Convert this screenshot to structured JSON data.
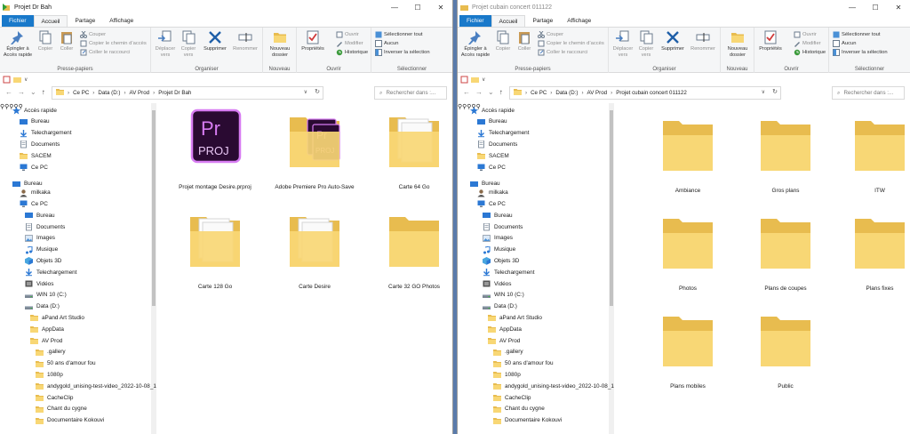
{
  "left": {
    "window_title": "Projet Dr Bah",
    "tabs": [
      "Fichier",
      "Accueil",
      "Partage",
      "Affichage"
    ],
    "ribbon": {
      "pin_label": "Épingler à Accès rapide",
      "copy_label": "Copier",
      "paste_label": "Coller",
      "cut_label": "Couper",
      "copy_path_label": "Copier le chemin d’accès",
      "paste_shortcut_label": "Coller le raccourci",
      "clipboard_group": "Presse-papiers",
      "move_to_label": "Déplacer vers",
      "copy_to_label": "Copier vers",
      "delete_label": "Supprimer",
      "rename_label": "Renommer",
      "organize_group": "Organiser",
      "new_folder_label": "Nouveau dossier",
      "new_group": "Nouveau",
      "properties_label": "Propriétés",
      "open_label": "Ouvrir",
      "modify_label": "Modifier",
      "history_label": "Historique",
      "open_group": "Ouvrir",
      "select_all_label": "Sélectionner tout",
      "select_none_label": "Aucun",
      "invert_label": "Inverser la sélection",
      "select_group": "Sélectionner"
    },
    "breadcrumb": [
      "Ce PC",
      "Data (D:)",
      "AV Prod",
      "Projet Dr Bah"
    ],
    "search_placeholder": "Rechercher dans :...",
    "nav": [
      {
        "label": "Accès rapide",
        "icon": "star-icon",
        "indent": 0,
        "pin": false
      },
      {
        "label": "Bureau",
        "icon": "desktop-icon",
        "indent": 1,
        "pin": true
      },
      {
        "label": "Telechargement",
        "icon": "download-icon",
        "indent": 1,
        "pin": true
      },
      {
        "label": "Documents",
        "icon": "documents-icon",
        "indent": 1,
        "pin": true
      },
      {
        "label": "SACEM",
        "icon": "folder-icon",
        "indent": 1,
        "pin": true
      },
      {
        "label": "Ce PC",
        "icon": "pc-icon",
        "indent": 1,
        "pin": true
      },
      {
        "label": "Bureau",
        "icon": "desktop-icon",
        "indent": 0,
        "pin": false
      },
      {
        "label": "milkaka",
        "icon": "user-icon",
        "indent": 1,
        "pin": false
      },
      {
        "label": "Ce PC",
        "icon": "pc-icon",
        "indent": 1,
        "pin": false
      },
      {
        "label": "Bureau",
        "icon": "desktop-icon",
        "indent": 2,
        "pin": false
      },
      {
        "label": "Documents",
        "icon": "documents-icon",
        "indent": 2,
        "pin": false
      },
      {
        "label": "Images",
        "icon": "images-icon",
        "indent": 2,
        "pin": false
      },
      {
        "label": "Musique",
        "icon": "music-icon",
        "indent": 2,
        "pin": false
      },
      {
        "label": "Objets 3D",
        "icon": "cube-icon",
        "indent": 2,
        "pin": false
      },
      {
        "label": "Telechargement",
        "icon": "download-icon",
        "indent": 2,
        "pin": false
      },
      {
        "label": "Vidéos",
        "icon": "video-icon",
        "indent": 2,
        "pin": false
      },
      {
        "label": "WIN 10 (C:)",
        "icon": "drive-icon",
        "indent": 2,
        "pin": false
      },
      {
        "label": "Data (D:)",
        "icon": "drive-icon",
        "indent": 2,
        "pin": false
      },
      {
        "label": "aPand Art Studio",
        "icon": "folder-icon",
        "indent": 3,
        "pin": false
      },
      {
        "label": "AppData",
        "icon": "folder-icon",
        "indent": 3,
        "pin": false
      },
      {
        "label": "AV Prod",
        "icon": "folder-icon",
        "indent": 3,
        "pin": false
      },
      {
        "label": ".gallery",
        "icon": "folder-icon",
        "indent": 4,
        "pin": false
      },
      {
        "label": "50 ans d'amour fou",
        "icon": "folder-icon",
        "indent": 4,
        "pin": false
      },
      {
        "label": "1080p",
        "icon": "folder-icon",
        "indent": 4,
        "pin": false
      },
      {
        "label": "andygold_unising-test-video_2022-10-08_13",
        "icon": "folder-icon",
        "indent": 4,
        "pin": false
      },
      {
        "label": "CacheClip",
        "icon": "folder-icon",
        "indent": 4,
        "pin": false
      },
      {
        "label": "Chant du cygne",
        "icon": "folder-icon",
        "indent": 4,
        "pin": false
      },
      {
        "label": "Documentaire Kokouvi",
        "icon": "folder-icon",
        "indent": 4,
        "pin": false
      }
    ],
    "items": [
      {
        "label": "Projet montage Desire.prproj",
        "kind": "prproj",
        "icon_text_top": "Pr",
        "icon_text_bottom": "PROJ"
      },
      {
        "label": "Adobe Premiere Pro Auto-Save",
        "kind": "folder-prproj",
        "icon_text_top": "Pr",
        "icon_text_bottom": "PROJ"
      },
      {
        "label": "Carte 64 Go",
        "kind": "folder-papers"
      },
      {
        "label": "Carte 128 Go",
        "kind": "folder-papers"
      },
      {
        "label": "Carte Desire",
        "kind": "folder-papers"
      },
      {
        "label": "Carte 32 GO Photos",
        "kind": "folder"
      }
    ]
  },
  "right": {
    "window_title": "Projet cubain concert 011122",
    "tabs": [
      "Fichier",
      "Accueil",
      "Partage",
      "Affichage"
    ],
    "ribbon": {
      "pin_label": "Épingler à Accès rapide",
      "copy_label": "Copier",
      "paste_label": "Coller",
      "cut_label": "Couper",
      "copy_path_label": "Copier le chemin d’accès",
      "paste_shortcut_label": "Coller le raccourci",
      "clipboard_group": "Presse-papiers",
      "move_to_label": "Déplacer vers",
      "copy_to_label": "Copier vers",
      "delete_label": "Supprimer",
      "rename_label": "Renommer",
      "organize_group": "Organiser",
      "new_folder_label": "Nouveau dossier",
      "new_group": "Nouveau",
      "properties_label": "Propriétés",
      "open_label": "Ouvrir",
      "modify_label": "Modifier",
      "history_label": "Historique",
      "open_group": "Ouvrir",
      "select_all_label": "Sélectionner tout",
      "select_none_label": "Aucun",
      "invert_label": "Inverser la sélection",
      "select_group": "Sélectionner"
    },
    "breadcrumb": [
      "Ce PC",
      "Data (D:)",
      "AV Prod",
      "Projet cubain concert 011122"
    ],
    "search_placeholder": "Rechercher dans :...",
    "nav": [
      {
        "label": "Accès rapide",
        "icon": "star-icon",
        "indent": 0,
        "pin": false
      },
      {
        "label": "Bureau",
        "icon": "desktop-icon",
        "indent": 1,
        "pin": true
      },
      {
        "label": "Telechargement",
        "icon": "download-icon",
        "indent": 1,
        "pin": true
      },
      {
        "label": "Documents",
        "icon": "documents-icon",
        "indent": 1,
        "pin": true
      },
      {
        "label": "SACEM",
        "icon": "folder-icon",
        "indent": 1,
        "pin": true
      },
      {
        "label": "Ce PC",
        "icon": "pc-icon",
        "indent": 1,
        "pin": true
      },
      {
        "label": "Bureau",
        "icon": "desktop-icon",
        "indent": 0,
        "pin": false
      },
      {
        "label": "milkaka",
        "icon": "user-icon",
        "indent": 1,
        "pin": false
      },
      {
        "label": "Ce PC",
        "icon": "pc-icon",
        "indent": 1,
        "pin": false
      },
      {
        "label": "Bureau",
        "icon": "desktop-icon",
        "indent": 2,
        "pin": false
      },
      {
        "label": "Documents",
        "icon": "documents-icon",
        "indent": 2,
        "pin": false
      },
      {
        "label": "Images",
        "icon": "images-icon",
        "indent": 2,
        "pin": false
      },
      {
        "label": "Musique",
        "icon": "music-icon",
        "indent": 2,
        "pin": false
      },
      {
        "label": "Objets 3D",
        "icon": "cube-icon",
        "indent": 2,
        "pin": false
      },
      {
        "label": "Telechargement",
        "icon": "download-icon",
        "indent": 2,
        "pin": false
      },
      {
        "label": "Vidéos",
        "icon": "video-icon",
        "indent": 2,
        "pin": false
      },
      {
        "label": "WIN 10 (C:)",
        "icon": "drive-icon",
        "indent": 2,
        "pin": false
      },
      {
        "label": "Data (D:)",
        "icon": "drive-icon",
        "indent": 2,
        "pin": false
      },
      {
        "label": "aPand Art Studio",
        "icon": "folder-icon",
        "indent": 3,
        "pin": false
      },
      {
        "label": "AppData",
        "icon": "folder-icon",
        "indent": 3,
        "pin": false
      },
      {
        "label": "AV Prod",
        "icon": "folder-icon",
        "indent": 3,
        "pin": false
      },
      {
        "label": ".gallery",
        "icon": "folder-icon",
        "indent": 4,
        "pin": false
      },
      {
        "label": "50 ans d'amour fou",
        "icon": "folder-icon",
        "indent": 4,
        "pin": false
      },
      {
        "label": "1080p",
        "icon": "folder-icon",
        "indent": 4,
        "pin": false
      },
      {
        "label": "andygold_unising-test-video_2022-10-08_13",
        "icon": "folder-icon",
        "indent": 4,
        "pin": false
      },
      {
        "label": "CacheClip",
        "icon": "folder-icon",
        "indent": 4,
        "pin": false
      },
      {
        "label": "Chant du cygne",
        "icon": "folder-icon",
        "indent": 4,
        "pin": false
      },
      {
        "label": "Documentaire Kokouvi",
        "icon": "folder-icon",
        "indent": 4,
        "pin": false
      }
    ],
    "items": [
      {
        "label": "Ambiance",
        "kind": "folder"
      },
      {
        "label": "Gros plans",
        "kind": "folder"
      },
      {
        "label": "ITW",
        "kind": "folder"
      },
      {
        "label": "Photos",
        "kind": "folder"
      },
      {
        "label": "Plans de coupes",
        "kind": "folder"
      },
      {
        "label": "Plans fixes",
        "kind": "folder"
      },
      {
        "label": "Plans mobiles",
        "kind": "folder"
      },
      {
        "label": "Public",
        "kind": "folder"
      }
    ]
  },
  "colors": {
    "file_tab": "#1979ca",
    "folder": "#f8d775",
    "folder_back": "#e8bc4f",
    "premiere_bg": "#2a0a32",
    "premiere_accent": "#d77cf2",
    "desktop_bg": "#5a7bab"
  }
}
